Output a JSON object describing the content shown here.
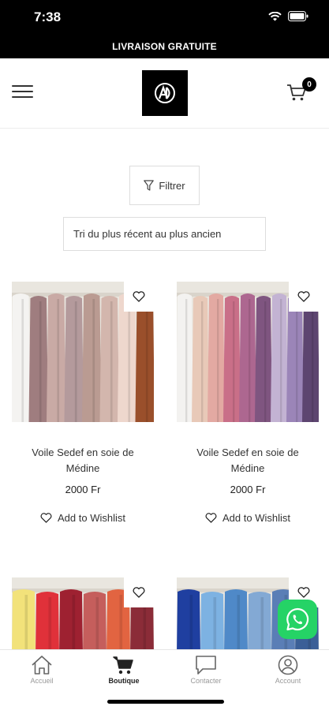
{
  "status_bar": {
    "time": "7:38"
  },
  "promo_banner": {
    "text": "LIVRAISON GRATUITE"
  },
  "header": {
    "cart_count": "0"
  },
  "filter_label": "Filtrer",
  "sort_label": "Tri du plus récent au plus ancien",
  "products": [
    {
      "name": "Voile Sedef en soie de Médine",
      "price": "2000 Fr",
      "wishlist_label": "Add to Wishlist",
      "colors": [
        "#f4f3f1",
        "#9f7d7f",
        "#c9aaa5",
        "#b49a9c",
        "#ba9b92",
        "#d3b6ad",
        "#eed7cd",
        "#9a4f2b"
      ]
    },
    {
      "name": "Voile Sedef en soie de Médine",
      "price": "2000 Fr",
      "wishlist_label": "Add to Wishlist",
      "colors": [
        "#f3f2f0",
        "#e8c9b8",
        "#e3a9a2",
        "#c96f88",
        "#ad6790",
        "#7f5580",
        "#c3b3d3",
        "#9b85b8",
        "#5d4570"
      ]
    },
    {
      "colors": [
        "#f2e27a",
        "#e0313a",
        "#9e2131",
        "#c55e5c",
        "#e26441",
        "#8b2c38"
      ]
    },
    {
      "colors": [
        "#1f3fa0",
        "#7db2e2",
        "#4f89c8",
        "#83a9d4",
        "#5a7eb6",
        "#3b5f97"
      ]
    }
  ],
  "tabs": [
    {
      "label": "Accueil",
      "icon": "home-icon"
    },
    {
      "label": "Boutique",
      "icon": "cart-icon"
    },
    {
      "label": "Contacter",
      "icon": "chat-icon"
    },
    {
      "label": "Account",
      "icon": "user-icon"
    }
  ],
  "colors": {
    "brand": "#000000",
    "whatsapp": "#25d366",
    "inactive_tab": "#999999"
  }
}
